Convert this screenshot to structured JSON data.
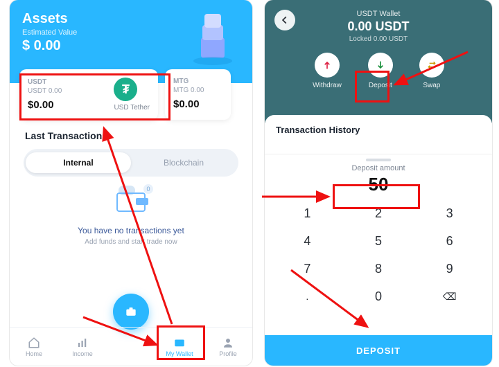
{
  "left": {
    "hero": {
      "title": "Assets",
      "subtitle": "Estimated Value",
      "value": "$ 0.00"
    },
    "cards": [
      {
        "symbol": "USDT",
        "amount": "USDT 0.00",
        "usd": "$0.00",
        "name": "USD Tether",
        "coin_glyph": "₮"
      },
      {
        "symbol": "MTG",
        "amount": "MTG 0.00",
        "usd": "$0.00"
      }
    ],
    "section": "Last Transactions",
    "tabs": {
      "internal": "Internal",
      "blockchain": "Blockchain"
    },
    "empty": {
      "badge": "0",
      "title": "You have no transactions yet",
      "subtitle": "Add funds and start trade now"
    },
    "nav": {
      "home": "Home",
      "income": "Income",
      "wallet": "My Wallet",
      "profile": "Profile"
    }
  },
  "right": {
    "header": {
      "sub": "USDT Wallet",
      "balance": "0.00 USDT",
      "locked": "Locked 0.00 USDT"
    },
    "actions": {
      "withdraw": "Withdraw",
      "deposit": "Deposit",
      "swap": "Swap"
    },
    "history_title": "Transaction History",
    "sheet": {
      "label": "Deposit amount",
      "value": "50",
      "button": "DEPOSIT",
      "keys": [
        "1",
        "2",
        "3",
        "4",
        "5",
        "6",
        "7",
        "8",
        "9",
        ".",
        "0",
        "⌫"
      ]
    }
  },
  "colors": {
    "accent": "#29b7ff",
    "teal": "#3a6e76",
    "annotation": "#e11"
  }
}
